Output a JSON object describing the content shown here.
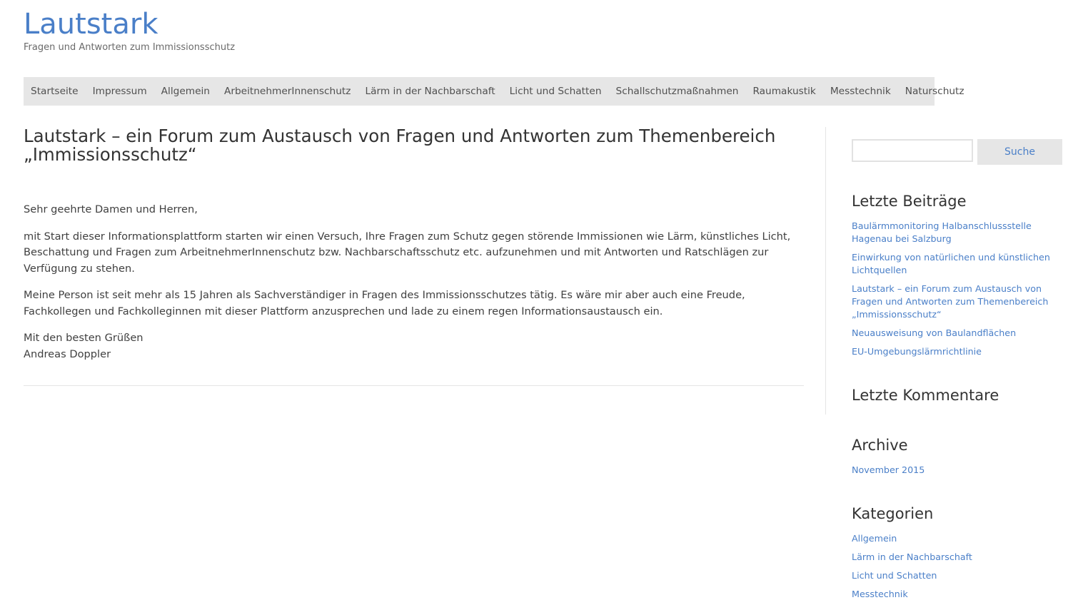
{
  "header": {
    "site_title": "Lautstark",
    "tagline": "Fragen und Antworten zum Immissionsschutz"
  },
  "nav": {
    "items": [
      "Startseite",
      "Impressum",
      "Allgemein",
      "ArbeitnehmerInnenschutz",
      "Lärm in der Nachbarschaft",
      "Licht und Schatten",
      "Schallschutzmaßnahmen",
      "Raumakustik",
      "Messtechnik",
      "Naturschutz"
    ]
  },
  "post": {
    "title": "Lautstark – ein Forum zum Austausch von Fragen und Antworten zum Themenbereich „Immissionsschutz“",
    "greeting": "Sehr geehrte Damen und Herren,",
    "paragraph_1": "mit Start dieser Informationsplattform starten wir einen Versuch, Ihre Fragen zum Schutz gegen störende Immissionen wie Lärm, künstliches Licht, Beschattung und Fragen zum ArbeitnehmerInnenschutz bzw. Nachbarschaftsschutz etc. aufzunehmen und mit Antworten und Ratschlägen zur Verfügung zu stehen.",
    "paragraph_2": "Meine Person ist seit mehr als 15 Jahren als Sachverständiger in Fragen des Immissionsschutzes tätig. Es wäre mir aber auch eine Freude, Fachkollegen und Fachkolleginnen mit dieser Plattform anzusprechen und lade zu einem regen Informationsaustausch ein.",
    "closing": "Mit den besten Grüßen",
    "author": "Andreas Doppler"
  },
  "sidebar": {
    "search": {
      "value": "",
      "button_label": "Suche"
    },
    "recent_posts": {
      "title": "Letzte Beiträge",
      "items": [
        "Baulärmmonitoring Halbanschlussstelle Hagenau bei Salzburg",
        "Einwirkung von natürlichen und künstlichen Lichtquellen",
        "Lautstark – ein Forum zum Austausch von Fragen und Antworten zum Themenbereich „Immissionsschutz“",
        "Neuausweisung von Baulandflächen",
        "EU-Umgebungslärmrichtlinie"
      ]
    },
    "recent_comments": {
      "title": "Letzte Kommentare"
    },
    "archive": {
      "title": "Archive",
      "items": [
        "November 2015"
      ]
    },
    "categories": {
      "title": "Kategorien",
      "items": [
        "Allgemein",
        "Lärm in der Nachbarschaft",
        "Licht und Schatten",
        "Messtechnik"
      ]
    }
  },
  "colors": {
    "link": "#4a7fc8",
    "nav_background": "#e6e6e6",
    "text": "#404040"
  }
}
